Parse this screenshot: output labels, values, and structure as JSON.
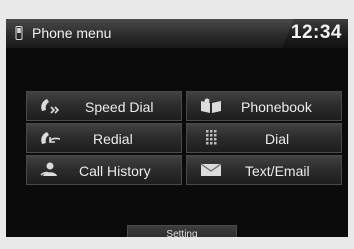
{
  "header": {
    "title": "Phone menu",
    "clock": "12:34",
    "icon": "phone-icon"
  },
  "menu": {
    "speed_dial": {
      "label": "Speed Dial",
      "icon": "speed-dial-icon"
    },
    "phonebook": {
      "label": "Phonebook",
      "icon": "phonebook-icon"
    },
    "redial": {
      "label": "Redial",
      "icon": "redial-icon"
    },
    "dial": {
      "label": "Dial",
      "icon": "keypad-icon"
    },
    "call_history": {
      "label": "Call History",
      "icon": "call-history-icon"
    },
    "text_email": {
      "label": "Text/Email",
      "icon": "envelope-icon"
    }
  },
  "footer": {
    "setting_label": "Setting"
  },
  "colors": {
    "screen_bg": "#0b0b0b",
    "bezel": "#e9e9e9",
    "text": "#ececec"
  }
}
